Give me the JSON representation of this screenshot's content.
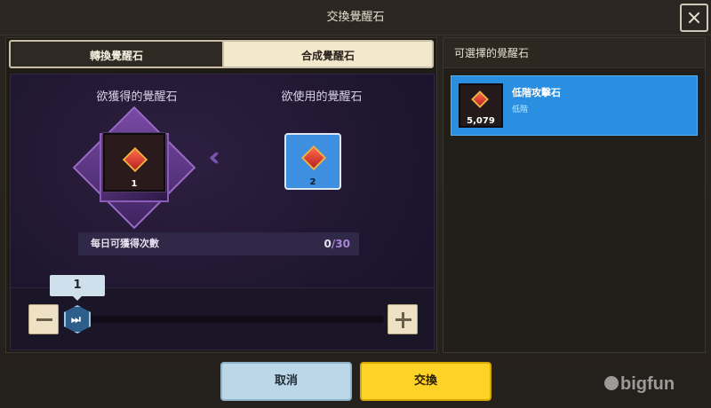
{
  "window": {
    "title": "交換覺醒石"
  },
  "tabs": [
    {
      "label": "轉換覺醒石",
      "selected": false
    },
    {
      "label": "合成覺醒石",
      "selected": true
    }
  ],
  "exchange": {
    "get_label": "欲獲得的覺醒石",
    "use_label": "欲使用的覺醒石",
    "get_count": "1",
    "use_count": "2",
    "daily_label": "每日可獲得次數",
    "daily_current": "0",
    "daily_separator": "/",
    "daily_max": "30"
  },
  "slider": {
    "quantity": "1",
    "handle_icon": "⏭"
  },
  "right_panel": {
    "title": "可選擇的覺醒石",
    "items": [
      {
        "name": "低階攻擊石",
        "grade": "低階",
        "count": "5,079"
      }
    ]
  },
  "buttons": {
    "cancel": "取消",
    "confirm": "交換"
  },
  "watermark": "bigfun",
  "colors": {
    "confirm": "#ffd227",
    "cancel": "#bcd7e8",
    "selected_item": "#2a8fe0",
    "use_slot": "#3f8fe0"
  }
}
